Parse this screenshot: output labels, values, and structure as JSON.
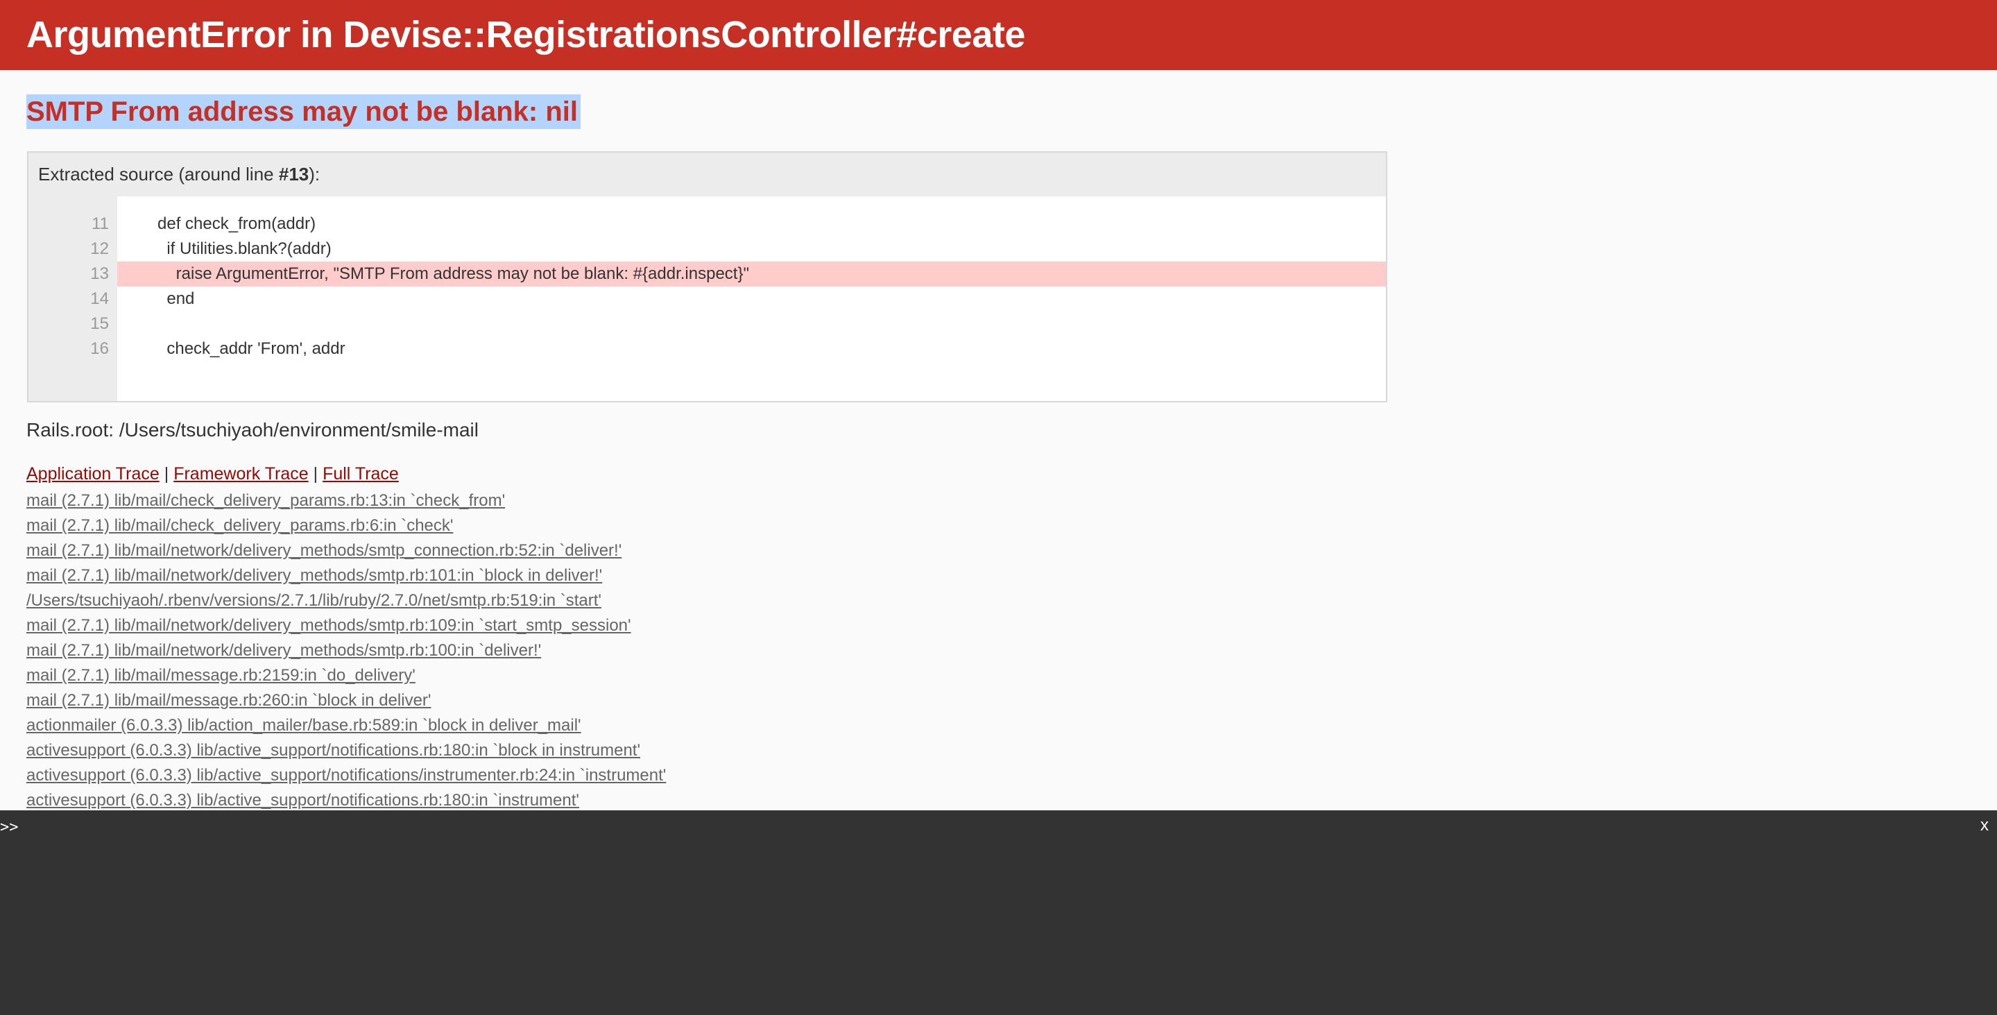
{
  "header": {
    "title": "ArgumentError in Devise::RegistrationsController#create"
  },
  "error_message": "SMTP From address may not be blank: nil",
  "source": {
    "label_prefix": "Extracted source (around line ",
    "label_line": "#13",
    "label_suffix": "):",
    "lines": [
      {
        "num": "11",
        "code": "      def check_from(addr)",
        "highlight": false
      },
      {
        "num": "12",
        "code": "        if Utilities.blank?(addr)",
        "highlight": false
      },
      {
        "num": "13",
        "code": "          raise ArgumentError, \"SMTP From address may not be blank: #{addr.inspect}\"",
        "highlight": true
      },
      {
        "num": "14",
        "code": "        end",
        "highlight": false
      },
      {
        "num": "15",
        "code": "",
        "highlight": false
      },
      {
        "num": "16",
        "code": "        check_addr 'From', addr",
        "highlight": false
      }
    ]
  },
  "rails_root": "Rails.root: /Users/tsuchiyaoh/environment/smile-mail",
  "trace_tabs": {
    "application": "Application Trace",
    "framework": "Framework Trace",
    "full": "Full Trace",
    "separator": "|"
  },
  "trace": [
    "mail (2.7.1) lib/mail/check_delivery_params.rb:13:in `check_from'",
    "mail (2.7.1) lib/mail/check_delivery_params.rb:6:in `check'",
    "mail (2.7.1) lib/mail/network/delivery_methods/smtp_connection.rb:52:in `deliver!'",
    "mail (2.7.1) lib/mail/network/delivery_methods/smtp.rb:101:in `block in deliver!'",
    "/Users/tsuchiyaoh/.rbenv/versions/2.7.1/lib/ruby/2.7.0/net/smtp.rb:519:in `start'",
    "mail (2.7.1) lib/mail/network/delivery_methods/smtp.rb:109:in `start_smtp_session'",
    "mail (2.7.1) lib/mail/network/delivery_methods/smtp.rb:100:in `deliver!'",
    "mail (2.7.1) lib/mail/message.rb:2159:in `do_delivery'",
    "mail (2.7.1) lib/mail/message.rb:260:in `block in deliver'",
    "actionmailer (6.0.3.3) lib/action_mailer/base.rb:589:in `block in deliver_mail'",
    "activesupport (6.0.3.3) lib/active_support/notifications.rb:180:in `block in instrument'",
    "activesupport (6.0.3.3) lib/active_support/notifications/instrumenter.rb:24:in `instrument'",
    "activesupport (6.0.3.3) lib/active_support/notifications.rb:180:in `instrument'"
  ],
  "console": {
    "prompt": ">>",
    "close_label": "x"
  },
  "colors": {
    "header_bg": "#C52F24",
    "highlight": "#FFCCCC",
    "selection": "#B3D4FC",
    "console_bg": "#333333",
    "link": "#980905"
  }
}
